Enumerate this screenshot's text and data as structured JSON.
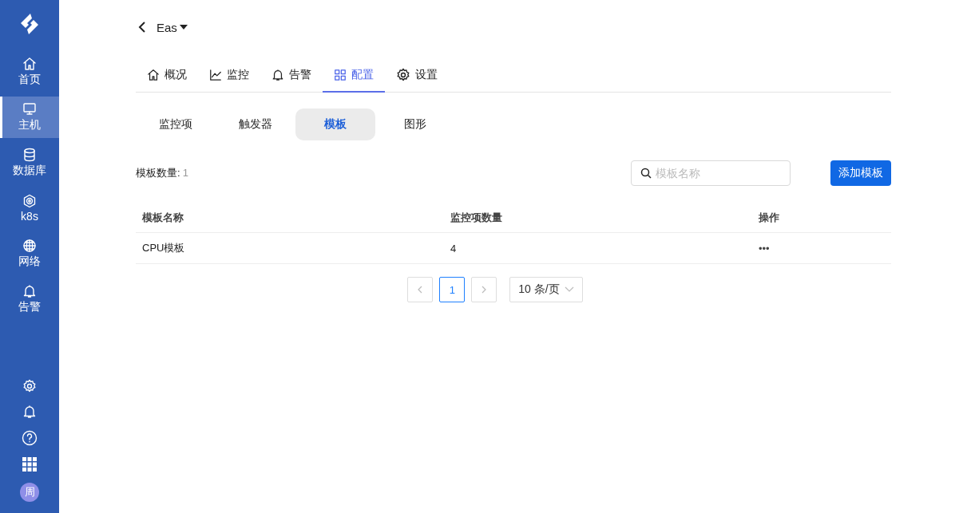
{
  "sidebar": {
    "items": [
      {
        "label": "首页",
        "selected": false
      },
      {
        "label": "主机",
        "selected": true
      },
      {
        "label": "数据库",
        "selected": false
      },
      {
        "label": "k8s",
        "selected": false
      },
      {
        "label": "网络",
        "selected": false
      },
      {
        "label": "告警",
        "selected": false
      }
    ],
    "avatar": "周"
  },
  "header": {
    "title": "Eas"
  },
  "tabs": [
    {
      "label": "概况",
      "selected": false
    },
    {
      "label": "监控",
      "selected": false
    },
    {
      "label": "告警",
      "selected": false
    },
    {
      "label": "配置",
      "selected": true
    },
    {
      "label": "设置",
      "selected": false
    }
  ],
  "subtabs": [
    {
      "label": "监控项",
      "selected": false
    },
    {
      "label": "触发器",
      "selected": false
    },
    {
      "label": "模板",
      "selected": true
    },
    {
      "label": "图形",
      "selected": false
    }
  ],
  "count": {
    "label": "模板数量:",
    "value": "1"
  },
  "search": {
    "placeholder": "模板名称"
  },
  "add_button": "添加模板",
  "table": {
    "columns": [
      "模板名称",
      "监控项数量",
      "操作"
    ],
    "rows": [
      [
        "CPU模板",
        "4",
        "•••"
      ]
    ]
  },
  "pagination": {
    "pages": [
      {
        "label": "1",
        "selected": true
      }
    ],
    "page_size": "10 条/页"
  }
}
